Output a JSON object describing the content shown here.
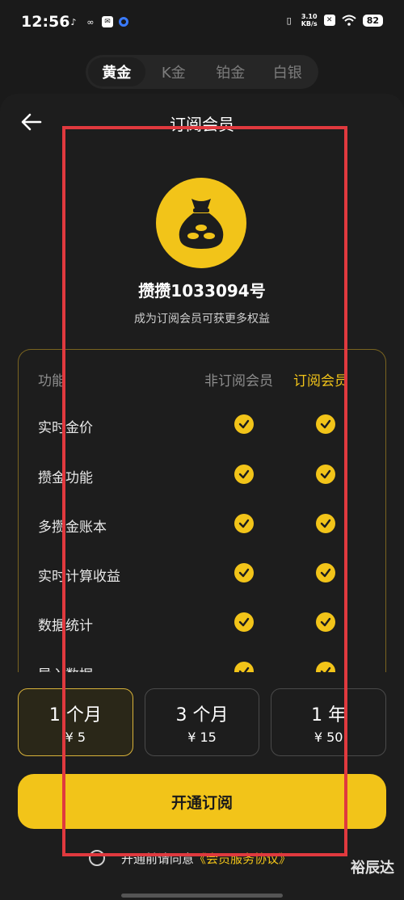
{
  "status_bar": {
    "time": "12:56",
    "net_speed_value": "3.10",
    "net_speed_unit": "KB/s",
    "battery": "82"
  },
  "metal_tabs": [
    "黄金",
    "K金",
    "铂金",
    "白银"
  ],
  "header": {
    "title": "订阅会员"
  },
  "profile": {
    "username": "攒攒1033094号",
    "subtitle": "成为订阅会员可获更多权益"
  },
  "features": {
    "col_feature": "功能",
    "col_non_member": "非订阅会员",
    "col_member": "订阅会员",
    "rows": [
      "实时金价",
      "攒金功能",
      "多攒金账本",
      "实时计算收益",
      "数据统计",
      "导入数据"
    ]
  },
  "plans": [
    {
      "duration": "1 个月",
      "price": "¥ 5",
      "selected": true
    },
    {
      "duration": "3 个月",
      "price": "¥ 15",
      "selected": false
    },
    {
      "duration": "1 年",
      "price": "¥ 50",
      "selected": false
    }
  ],
  "subscribe_label": "开通订阅",
  "agreement": {
    "prefix": "开通前请同意",
    "link": "《会员服务协议》"
  },
  "watermark": "裕辰达",
  "colors": {
    "accent": "#f2c419",
    "annotation": "#e0393e"
  }
}
